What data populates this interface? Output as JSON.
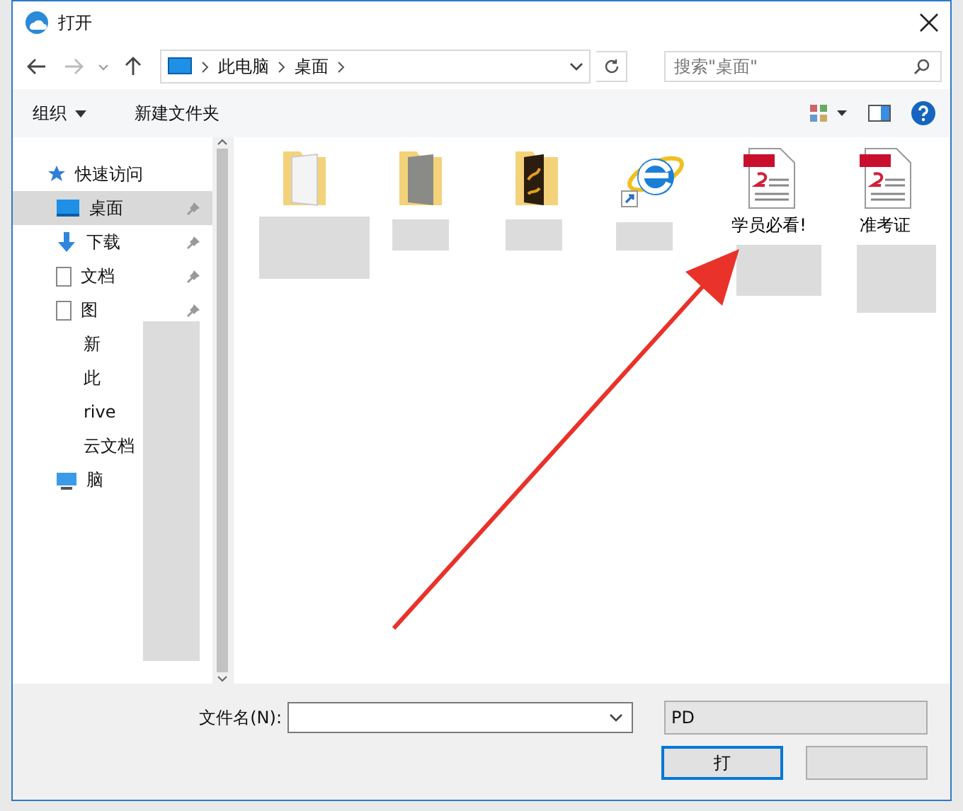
{
  "window": {
    "title": "打开"
  },
  "address": {
    "crumbs": [
      "此电脑",
      "桌面"
    ]
  },
  "search": {
    "placeholder": "搜索\"桌面\""
  },
  "toolbar": {
    "organize": "组织",
    "new_folder": "新建文件夹"
  },
  "sidebar": {
    "items": [
      {
        "label": "快速访问",
        "kind": "star",
        "selected": false,
        "pinned": false
      },
      {
        "label": "桌面",
        "kind": "desktop",
        "selected": true,
        "pinned": true
      },
      {
        "label": "下载",
        "kind": "download",
        "selected": false,
        "pinned": true
      },
      {
        "label": "文档",
        "kind": "doc",
        "selected": false,
        "pinned": true
      },
      {
        "label": "图",
        "kind": "doc",
        "selected": false,
        "pinned": true
      },
      {
        "label": "新",
        "kind": "blank",
        "selected": false,
        "pinned": false
      },
      {
        "label": "此",
        "kind": "blank",
        "selected": false,
        "pinned": false
      },
      {
        "label": "rive",
        "kind": "blank",
        "selected": false,
        "pinned": false
      },
      {
        "label": "云文档",
        "kind": "blank",
        "selected": false,
        "pinned": false
      },
      {
        "label": "脑",
        "kind": "computer",
        "selected": false,
        "pinned": false
      }
    ]
  },
  "files": [
    {
      "kind": "folder"
    },
    {
      "kind": "folder-dark"
    },
    {
      "kind": "folder-art"
    },
    {
      "kind": "ie-shortcut"
    },
    {
      "kind": "pdf",
      "label": "学员必看!"
    },
    {
      "kind": "pdf",
      "label": "准考证"
    }
  ],
  "footer": {
    "filename_label": "文件名(N):",
    "filetype": "PD",
    "open_button": "打"
  }
}
